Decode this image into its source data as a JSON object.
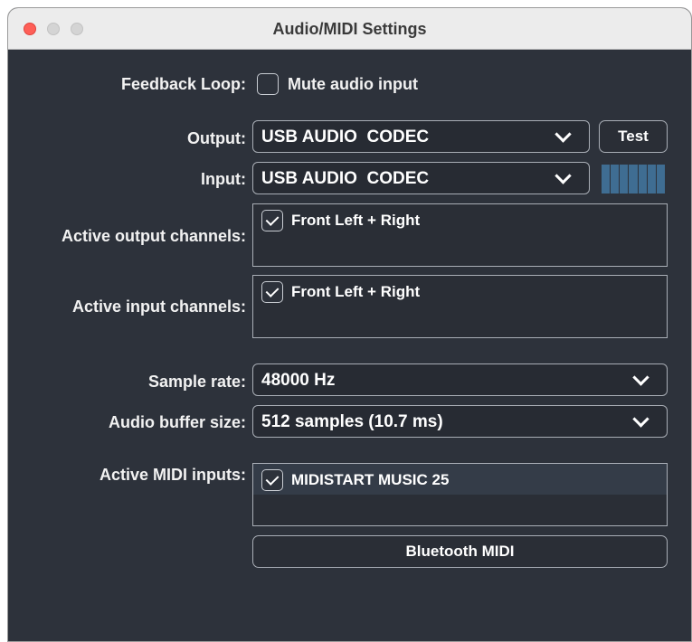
{
  "window": {
    "title": "Audio/MIDI Settings"
  },
  "feedback": {
    "label": "Feedback Loop:",
    "checkbox_label": "Mute audio input",
    "checked": false
  },
  "output": {
    "label": "Output:",
    "value": "USB AUDIO  CODEC",
    "test_label": "Test"
  },
  "input": {
    "label": "Input:",
    "value": "USB AUDIO  CODEC",
    "level_meter_segments": 7
  },
  "active_output_channels": {
    "label": "Active output channels:",
    "items": [
      {
        "label": "Front Left + Right",
        "checked": true
      }
    ]
  },
  "active_input_channels": {
    "label": "Active input channels:",
    "items": [
      {
        "label": "Front Left + Right",
        "checked": true
      }
    ]
  },
  "sample_rate": {
    "label": "Sample rate:",
    "value": "48000 Hz"
  },
  "buffer_size": {
    "label": "Audio buffer size:",
    "value": "512 samples (10.7 ms)"
  },
  "midi_inputs": {
    "label": "Active MIDI inputs:",
    "items": [
      {
        "label": "MIDISTART MUSIC 25",
        "checked": true
      }
    ]
  },
  "bluetooth": {
    "label": "Bluetooth MIDI"
  },
  "colors": {
    "panel_bg": "#2d323b",
    "meter": "#3f6d92",
    "close": "#fe5f57"
  }
}
